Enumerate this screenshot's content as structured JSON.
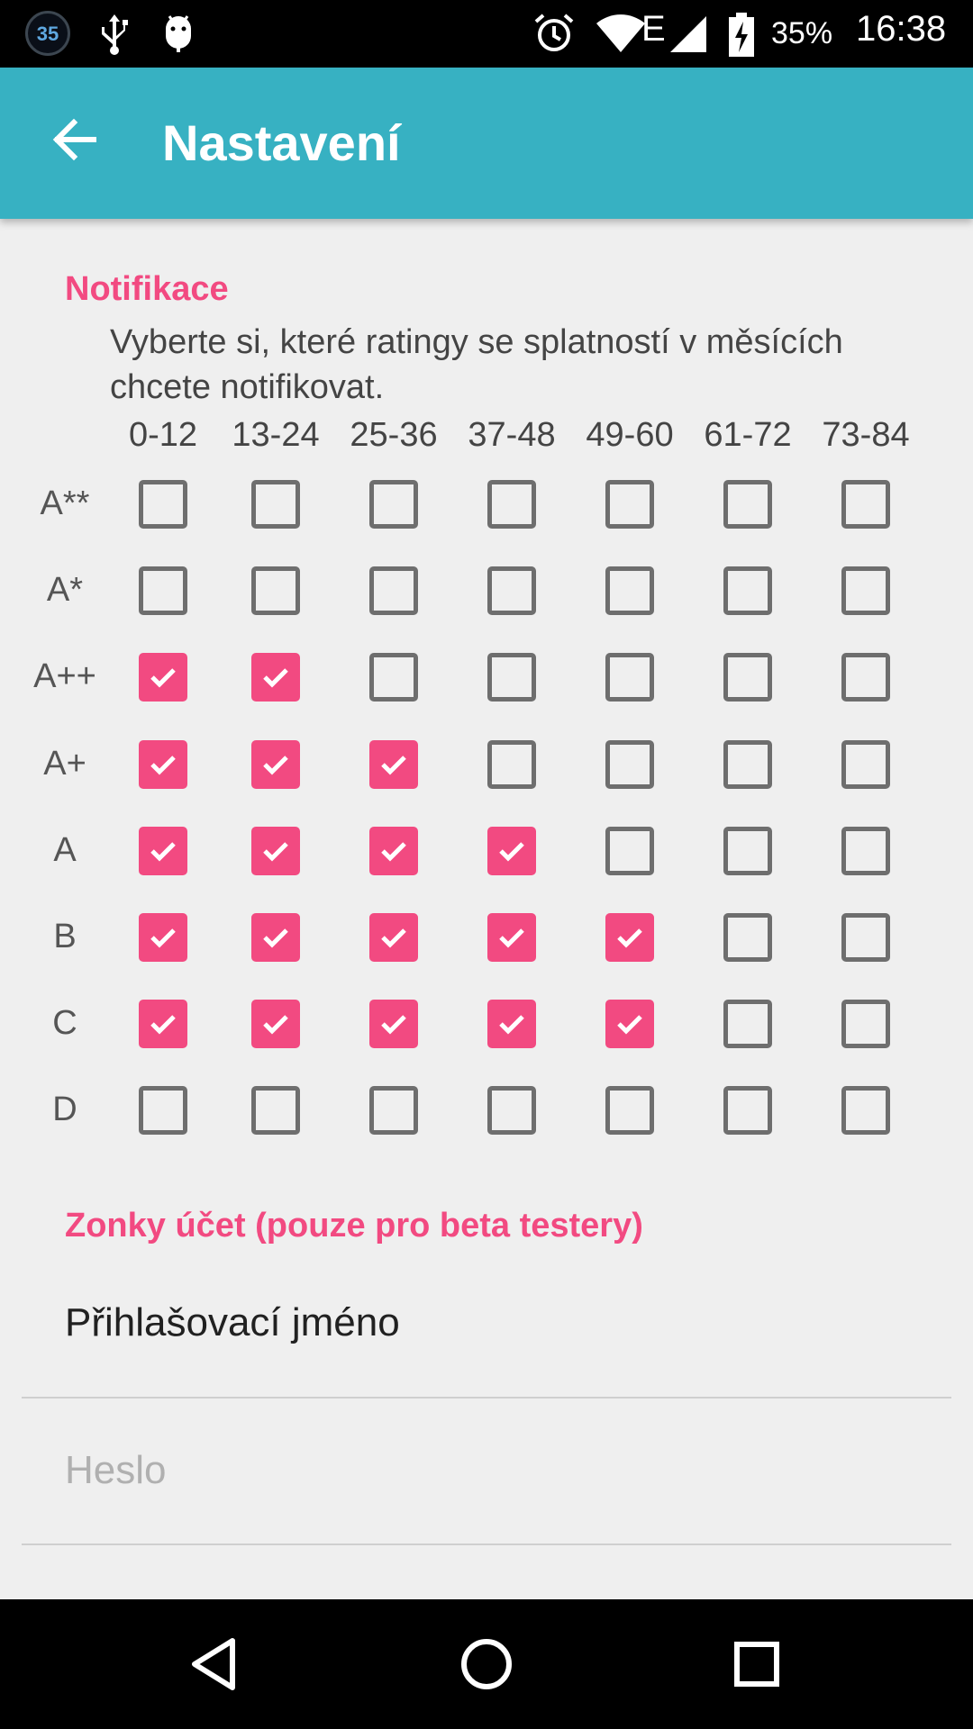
{
  "status_bar": {
    "notification_count": "35",
    "battery": "35%",
    "time": "16:38",
    "network_type": "E",
    "icons": [
      "notification-badge",
      "usb-icon",
      "android-debug-icon",
      "alarm-icon",
      "wifi-icon",
      "signal-icon",
      "battery-charging-icon"
    ]
  },
  "app_bar": {
    "title": "Nastavení",
    "back_icon": "arrow-back-icon",
    "color": "#37b1c2"
  },
  "notifications": {
    "title": "Notifikace",
    "description": "Vyberte si, které ratingy se splatností v měsících chcete notifikovat.",
    "columns": [
      "0-12",
      "13-24",
      "25-36",
      "37-48",
      "49-60",
      "61-72",
      "73-84"
    ],
    "rows": [
      {
        "label": "A**",
        "checked": [
          false,
          false,
          false,
          false,
          false,
          false,
          false
        ]
      },
      {
        "label": "A*",
        "checked": [
          false,
          false,
          false,
          false,
          false,
          false,
          false
        ]
      },
      {
        "label": "A++",
        "checked": [
          true,
          true,
          false,
          false,
          false,
          false,
          false
        ]
      },
      {
        "label": "A+",
        "checked": [
          true,
          true,
          true,
          false,
          false,
          false,
          false
        ]
      },
      {
        "label": "A",
        "checked": [
          true,
          true,
          true,
          true,
          false,
          false,
          false
        ]
      },
      {
        "label": "B",
        "checked": [
          true,
          true,
          true,
          true,
          true,
          false,
          false
        ]
      },
      {
        "label": "C",
        "checked": [
          true,
          true,
          true,
          true,
          true,
          false,
          false
        ]
      },
      {
        "label": "D",
        "checked": [
          false,
          false,
          false,
          false,
          false,
          false,
          false
        ]
      }
    ]
  },
  "account": {
    "title": "Zonky účet (pouze pro beta testery)",
    "username_value": "Přihlašovací jméno",
    "password_placeholder": "Heslo"
  },
  "nav_bar": {
    "icons": [
      "back-triangle-icon",
      "home-circle-icon",
      "recents-square-icon"
    ]
  },
  "colors": {
    "accent": "#f24a81",
    "primary": "#37b1c2",
    "background": "#efefef"
  }
}
